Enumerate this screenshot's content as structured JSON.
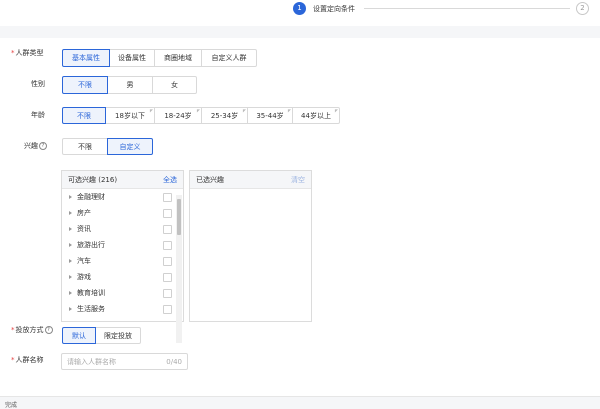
{
  "stepper": {
    "step1_number": "1",
    "step1_label": "设置定向条件",
    "step2_number": "2"
  },
  "audience_type": {
    "label": "人群类型",
    "options": [
      "基本属性",
      "设备属性",
      "商圈地域",
      "自定义人群"
    ],
    "selected": "基本属性"
  },
  "gender": {
    "label": "性别",
    "options": [
      "不限",
      "男",
      "女"
    ],
    "selected": "不限"
  },
  "age": {
    "label": "年龄",
    "options": [
      "不限",
      "18岁以下",
      "18-24岁",
      "25-34岁",
      "35-44岁",
      "44岁以上"
    ],
    "selected": "不限"
  },
  "interest": {
    "label": "兴趣",
    "options": [
      "不限",
      "自定义"
    ],
    "selected": "自定义",
    "available_title": "可选兴趣",
    "available_count": "(216)",
    "select_all": "全选",
    "selected_title": "已选兴趣",
    "clear": "清空",
    "items": [
      "金融理财",
      "房产",
      "资讯",
      "旅游出行",
      "汽车",
      "游戏",
      "教育培训",
      "生活服务"
    ]
  },
  "delivery_mode": {
    "label": "投放方式",
    "options": [
      "默认",
      "限定投放"
    ],
    "selected": "默认"
  },
  "audience_name": {
    "label": "人群名称",
    "placeholder": "请输入人群名称",
    "counter": "0/40"
  },
  "footer": {
    "text": "完成"
  },
  "colors": {
    "accent": "#2b66d9",
    "required": "#e53e3e"
  }
}
